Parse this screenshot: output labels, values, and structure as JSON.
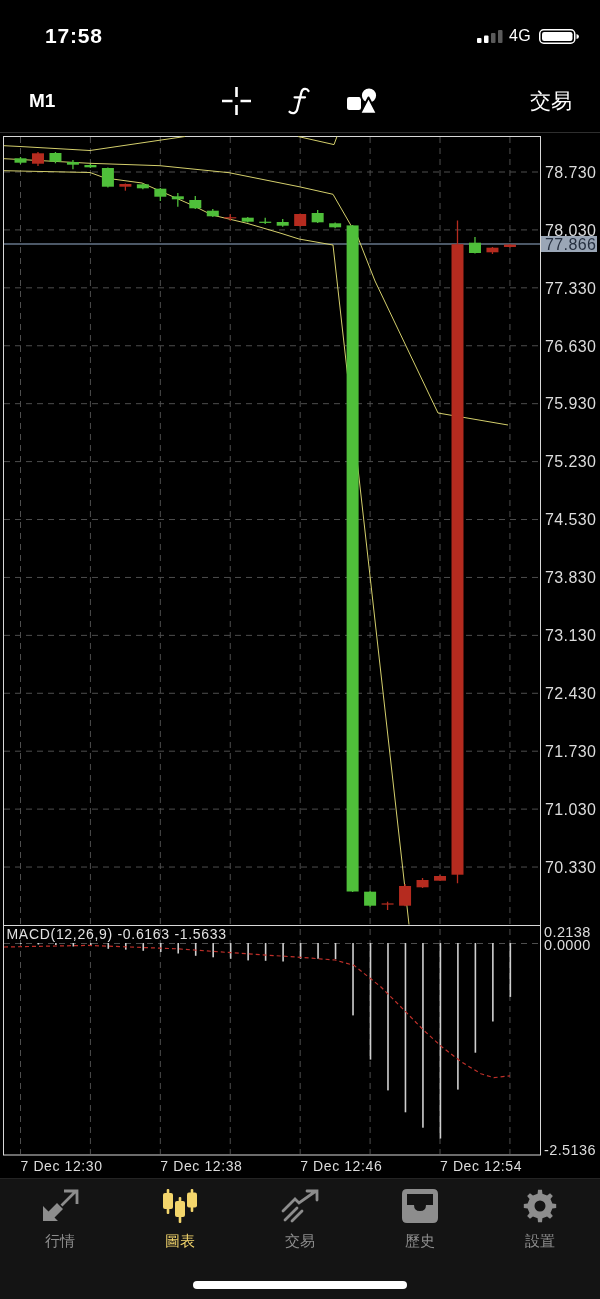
{
  "status_bar": {
    "time": "17:58",
    "network": "4G"
  },
  "toolbar": {
    "timeframe": "M1",
    "trade": "交易"
  },
  "chart": {
    "price_axis": [
      "78.730",
      "78.030",
      "77.330",
      "76.630",
      "75.930",
      "75.230",
      "74.530",
      "73.830",
      "73.130",
      "72.430",
      "71.730",
      "71.030",
      "70.330"
    ],
    "current_price": "77.866",
    "indicator_label": "MACD(12,26,9) -0.6163 -1.5633",
    "indicator_axis": [
      "0.2138",
      "0.0000",
      "-2.5136"
    ],
    "time_axis": [
      "7 Dec 12:30",
      "7 Dec 12:38",
      "7 Dec 12:46",
      "7 Dec 12:54"
    ]
  },
  "tab_bar": [
    {
      "label": "行情",
      "selected": false
    },
    {
      "label": "圖表",
      "selected": true
    },
    {
      "label": "交易",
      "selected": false
    },
    {
      "label": "歷史",
      "selected": false
    },
    {
      "label": "設置",
      "selected": false
    }
  ]
}
